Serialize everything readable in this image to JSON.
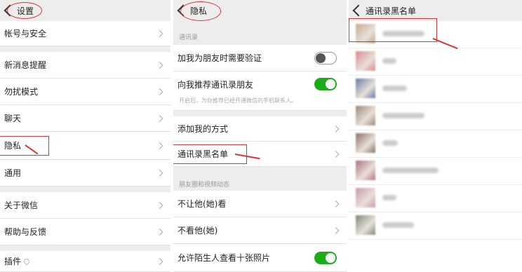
{
  "panel1": {
    "title": "设置",
    "items": [
      "帐号与安全",
      "新消息提醒",
      "勿扰模式",
      "聊天",
      "隐私",
      "通用",
      "关于微信",
      "帮助与反馈",
      "插件"
    ]
  },
  "panel2": {
    "title": "隐私",
    "section1": "通讯录",
    "add_verify": "加我为朋友时需要验证",
    "recommend": "向我推荐通讯录朋友",
    "recommend_sub": "开启后，为你推荐已经开通微信的手机联系人。",
    "add_method": "添加我的方式",
    "blacklist": "通讯录黑名单",
    "section2": "朋友圈和视频动态",
    "hide_from": "不让他(她)看",
    "not_see": "不看他(她)",
    "stranger_photos": "允许陌生人查看十张照片"
  },
  "panel3": {
    "title": "通讯录黑名单",
    "avatar_colors": [
      "#c7a98f",
      "#d88a8f",
      "#6a7aa8",
      "#9c8778",
      "#8a7066",
      "#b07080",
      "#c99aa8",
      "#7c8a78"
    ],
    "blur_widths": [
      60,
      20,
      35,
      60,
      22,
      80,
      20,
      45
    ]
  },
  "colors": {
    "accent": "#1aad19",
    "annotation": "#dd3333"
  }
}
